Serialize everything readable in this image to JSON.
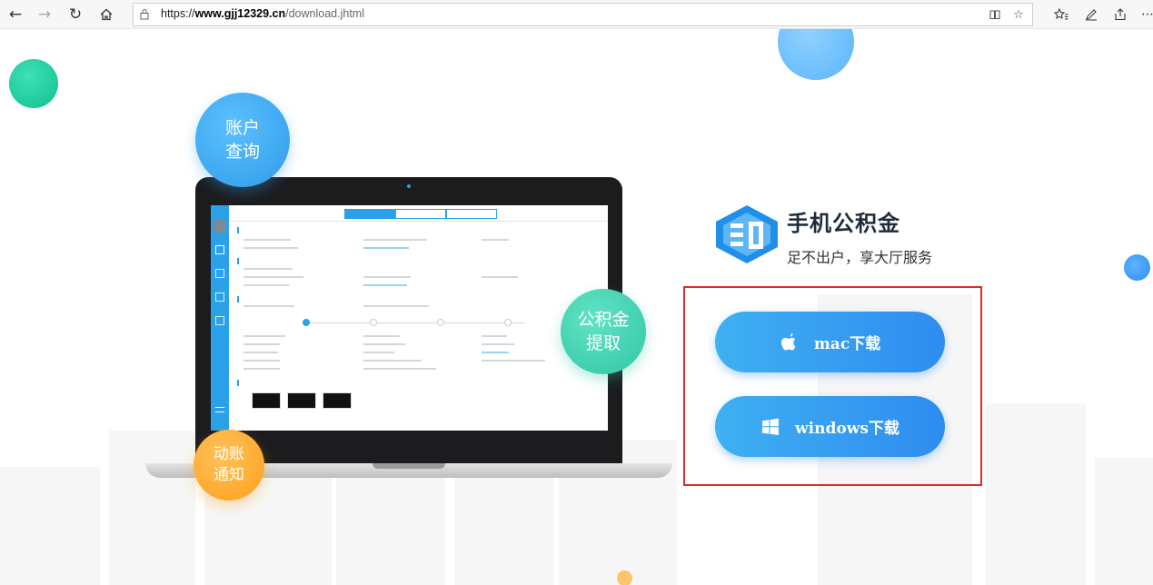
{
  "browser": {
    "url_prefix": "https://",
    "url_domain": "www.gjj12329.cn",
    "url_path": "/download.jhtml",
    "icons": [
      "back-icon",
      "forward-icon",
      "refresh-icon",
      "home-icon",
      "lock-icon",
      "reading-view-icon",
      "favorite-star-icon",
      "favorites-icon",
      "pen-icon",
      "share-icon",
      "more-icon"
    ]
  },
  "bubbles": {
    "account_line1": "账户",
    "account_line2": "查询",
    "fund_line1": "公积金",
    "fund_line2": "提取",
    "notice_line1": "动账",
    "notice_line2": "通知"
  },
  "brand": {
    "title": "手机公积金",
    "slogan": "足不出户，享大厅服务"
  },
  "downloads": {
    "mac_label": "mac下载",
    "windows_label": "windows下载"
  },
  "colors": {
    "accent": "#2e8cf0",
    "highlight_border": "#e02a2a",
    "bubble_blue": "#2f9be8",
    "bubble_green": "#2fc7a6",
    "bubble_orange": "#ff9f1a"
  }
}
